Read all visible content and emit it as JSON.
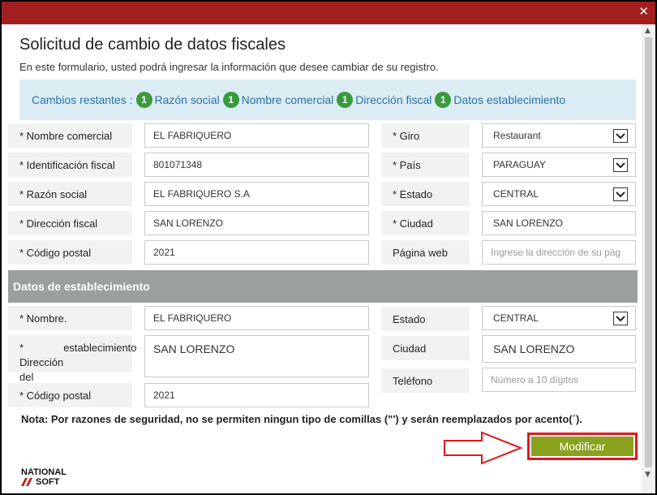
{
  "window": {
    "close_glyph": "✕"
  },
  "header": {
    "title": "Solicitud de cambio de datos fiscales",
    "intro": "En este formulario, usted podrá ingresar la información que desee cambiar de su registro."
  },
  "banner": {
    "prefix": "Cambios restantes :",
    "items": [
      {
        "count": "1",
        "label": "Razón social"
      },
      {
        "count": "1",
        "label": "Nombre comercial"
      },
      {
        "count": "1",
        "label": "Dirección fiscal"
      },
      {
        "count": "1",
        "label": "Datos establecimiento"
      }
    ]
  },
  "fiscal": {
    "nombre_comercial": {
      "label": "* Nombre comercial",
      "value": "EL FABRIQUERO"
    },
    "identificacion": {
      "label": "* Identificación fiscal",
      "value": "801071348"
    },
    "razon_social": {
      "label": "* Razón social",
      "value": "EL FABRIQUERO S.A"
    },
    "direccion": {
      "label": "* Dirección fiscal",
      "value": "SAN LORENZO"
    },
    "codigo_postal": {
      "label": "* Código postal",
      "value": "2021"
    },
    "giro": {
      "label": "* Giro",
      "value": "Restaurant"
    },
    "pais": {
      "label": "* País",
      "value": "PARAGUAY"
    },
    "estado": {
      "label": "* Estado",
      "value": "CENTRAL"
    },
    "ciudad": {
      "label": "* Ciudad",
      "value": "SAN LORENZO"
    },
    "web": {
      "label": "Página web",
      "placeholder": "Ingrese la dirección de su pág"
    }
  },
  "establecimiento": {
    "section_title": "Datos de establecimiento",
    "nombre": {
      "label": "* Nombre.",
      "value": "EL FABRIQUERO"
    },
    "direccion": {
      "label_line1": "* Dirección del",
      "label_line2": "establecimiento",
      "value": "SAN LORENZO"
    },
    "codigo_postal": {
      "label": "* Código postal",
      "value": "2021"
    },
    "estado": {
      "label": "Estado",
      "value": "CENTRAL"
    },
    "ciudad": {
      "label": "Ciudad",
      "value": "SAN LORENZO"
    },
    "telefono": {
      "label": "Teléfono",
      "placeholder": "Número a 10 dígitos"
    }
  },
  "note": "Nota: Por razones de seguridad, no se permiten ningun tipo de comillas (\"') y serán reemplazados por acento(´).",
  "actions": {
    "modify_label": "Modificar"
  },
  "logo": {
    "line1": "NATIONAL",
    "line2": "SOFT"
  },
  "colors": {
    "titlebar": "#a31f1f",
    "badge": "#3a9a3e",
    "button": "#8ba21e",
    "highlight": "#e0191e",
    "link": "#2b73a8"
  }
}
